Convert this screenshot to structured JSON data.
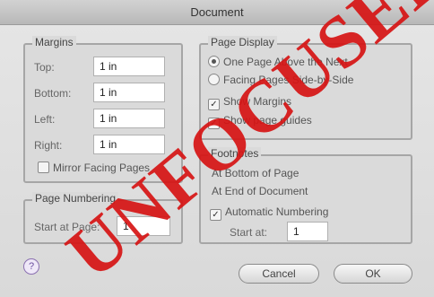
{
  "window": {
    "title": "Document"
  },
  "margins": {
    "legend": "Margins",
    "top_label": "Top:",
    "top_value": "1 in",
    "bottom_label": "Bottom:",
    "bottom_value": "1 in",
    "left_label": "Left:",
    "left_value": "1 in",
    "right_label": "Right:",
    "right_value": "1 in",
    "mirror_label": "Mirror Facing Pages",
    "mirror_checked": false
  },
  "page_numbering": {
    "legend": "Page Numbering",
    "start_label": "Start at Page:",
    "start_value": "1"
  },
  "page_display": {
    "legend": "Page Display",
    "option_one": "One Page Above the Next",
    "option_two": "Facing Pages Side-by-Side",
    "selected": "option_one",
    "show_margins": "Show Margins",
    "show_guides": "Show page guides",
    "show_margins_checked": true,
    "show_guides_checked": true
  },
  "footnotes": {
    "legend": "Footnotes",
    "bottom_of_page": "At Bottom of Page",
    "end_of_document": "At End of Document",
    "automatic": "Automatic Numbering",
    "automatic_checked": true,
    "start_label": "Start at:",
    "start_value": "1"
  },
  "buttons": {
    "cancel": "Cancel",
    "ok": "OK",
    "help": "?"
  },
  "stamp": {
    "text": "UNFOCUSED",
    "color": "#d61414"
  }
}
